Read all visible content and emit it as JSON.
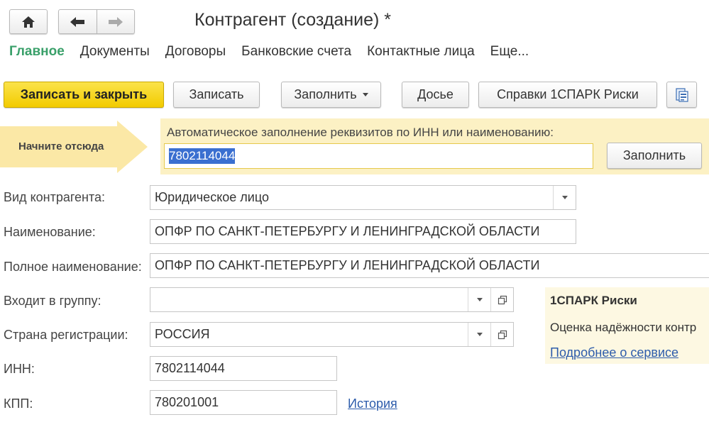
{
  "window": {
    "title": "Контрагент (создание) *"
  },
  "tabs": [
    {
      "label": "Главное"
    },
    {
      "label": "Документы"
    },
    {
      "label": "Договоры"
    },
    {
      "label": "Банковские счета"
    },
    {
      "label": "Контактные лица"
    },
    {
      "label": "Еще..."
    }
  ],
  "toolbar": {
    "save_close": "Записать и закрыть",
    "save": "Записать",
    "fill": "Заполнить",
    "dossier": "Досье",
    "spark": "Справки 1СПАРК Риски"
  },
  "start": {
    "label": "Начните отсюда"
  },
  "autofill": {
    "label": "Автоматическое заполнение реквизитов по ИНН или наименованию:",
    "value": "7802114044",
    "button": "Заполнить"
  },
  "form": {
    "type_label": "Вид контрагента:",
    "type_value": "Юридическое лицо",
    "name_label": "Наименование:",
    "name_value": "ОПФР ПО САНКТ-ПЕТЕРБУРГУ И ЛЕНИНГРАДСКОЙ ОБЛАСТИ",
    "full_name_label": "Полное наименование:",
    "full_name_value": "ОПФР ПО САНКТ-ПЕТЕРБУРГУ И ЛЕНИНГРАДСКОЙ ОБЛАСТИ",
    "group_label": "Входит в группу:",
    "group_value": "",
    "country_label": "Страна регистрации:",
    "country_value": "РОССИЯ",
    "inn_label": "ИНН:",
    "inn_value": "7802114044",
    "kpp_label": "КПП:",
    "kpp_value": "780201001",
    "history_link": "История"
  },
  "spark_panel": {
    "title": "1СПАРК Риски",
    "description": "Оценка надёжности контр",
    "link": "Подробнее о сервисе"
  },
  "colors": {
    "accent_green": "#3aa06a",
    "primary_yellow": "#f2cb00",
    "autofill_panel": "#fcf1c4",
    "link": "#2d5cab",
    "selection": "#3a6fd0"
  }
}
